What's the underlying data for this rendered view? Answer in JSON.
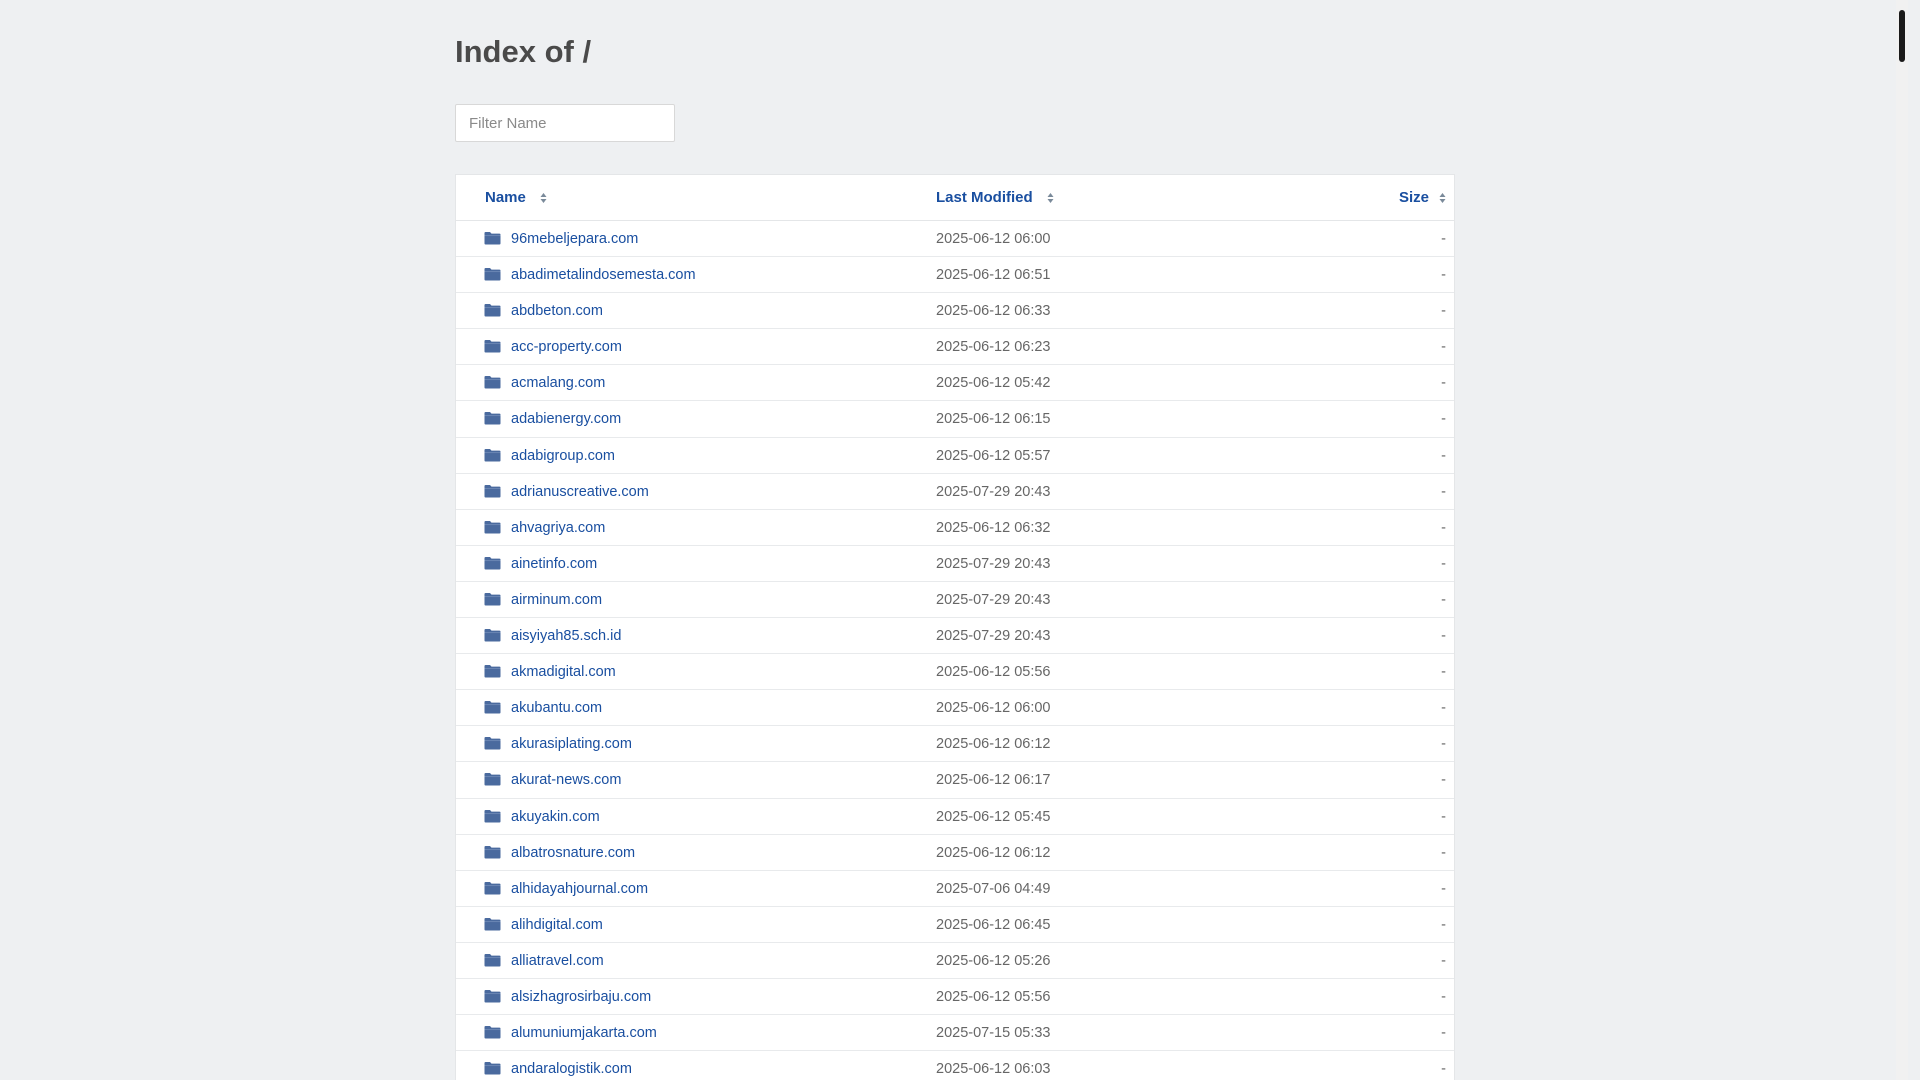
{
  "page": {
    "title": "Index of /",
    "filter_placeholder": "Filter Name"
  },
  "columns": {
    "name": "Name",
    "last_modified": "Last Modified",
    "size": "Size"
  },
  "icons": {
    "entry_icon": "folder-icon",
    "sort_icon": "sort-arrows-icon"
  },
  "colors": {
    "link": "#1a4fa0",
    "folder": "#4a6a9e",
    "background": "#eef0f2"
  },
  "entries": [
    {
      "name": "96mebeljepara.com",
      "modified": "2025-06-12 06:00",
      "size": "-"
    },
    {
      "name": "abadimetalindosemesta.com",
      "modified": "2025-06-12 06:51",
      "size": "-"
    },
    {
      "name": "abdbeton.com",
      "modified": "2025-06-12 06:33",
      "size": "-"
    },
    {
      "name": "acc-property.com",
      "modified": "2025-06-12 06:23",
      "size": "-"
    },
    {
      "name": "acmalang.com",
      "modified": "2025-06-12 05:42",
      "size": "-"
    },
    {
      "name": "adabienergy.com",
      "modified": "2025-06-12 06:15",
      "size": "-"
    },
    {
      "name": "adabigroup.com",
      "modified": "2025-06-12 05:57",
      "size": "-"
    },
    {
      "name": "adrianuscreative.com",
      "modified": "2025-07-29 20:43",
      "size": "-"
    },
    {
      "name": "ahvagriya.com",
      "modified": "2025-06-12 06:32",
      "size": "-"
    },
    {
      "name": "ainetinfo.com",
      "modified": "2025-07-29 20:43",
      "size": "-"
    },
    {
      "name": "airminum.com",
      "modified": "2025-07-29 20:43",
      "size": "-"
    },
    {
      "name": "aisyiyah85.sch.id",
      "modified": "2025-07-29 20:43",
      "size": "-"
    },
    {
      "name": "akmadigital.com",
      "modified": "2025-06-12 05:56",
      "size": "-"
    },
    {
      "name": "akubantu.com",
      "modified": "2025-06-12 06:00",
      "size": "-"
    },
    {
      "name": "akurasiplating.com",
      "modified": "2025-06-12 06:12",
      "size": "-"
    },
    {
      "name": "akurat-news.com",
      "modified": "2025-06-12 06:17",
      "size": "-"
    },
    {
      "name": "akuyakin.com",
      "modified": "2025-06-12 05:45",
      "size": "-"
    },
    {
      "name": "albatrosnature.com",
      "modified": "2025-06-12 06:12",
      "size": "-"
    },
    {
      "name": "alhidayahjournal.com",
      "modified": "2025-07-06 04:49",
      "size": "-"
    },
    {
      "name": "alihdigital.com",
      "modified": "2025-06-12 06:45",
      "size": "-"
    },
    {
      "name": "alliatravel.com",
      "modified": "2025-06-12 05:26",
      "size": "-"
    },
    {
      "name": "alsizhagrosirbaju.com",
      "modified": "2025-06-12 05:56",
      "size": "-"
    },
    {
      "name": "alumuniumjakarta.com",
      "modified": "2025-07-15 05:33",
      "size": "-"
    },
    {
      "name": "andaralogistik.com",
      "modified": "2025-06-12 06:03",
      "size": "-"
    }
  ]
}
